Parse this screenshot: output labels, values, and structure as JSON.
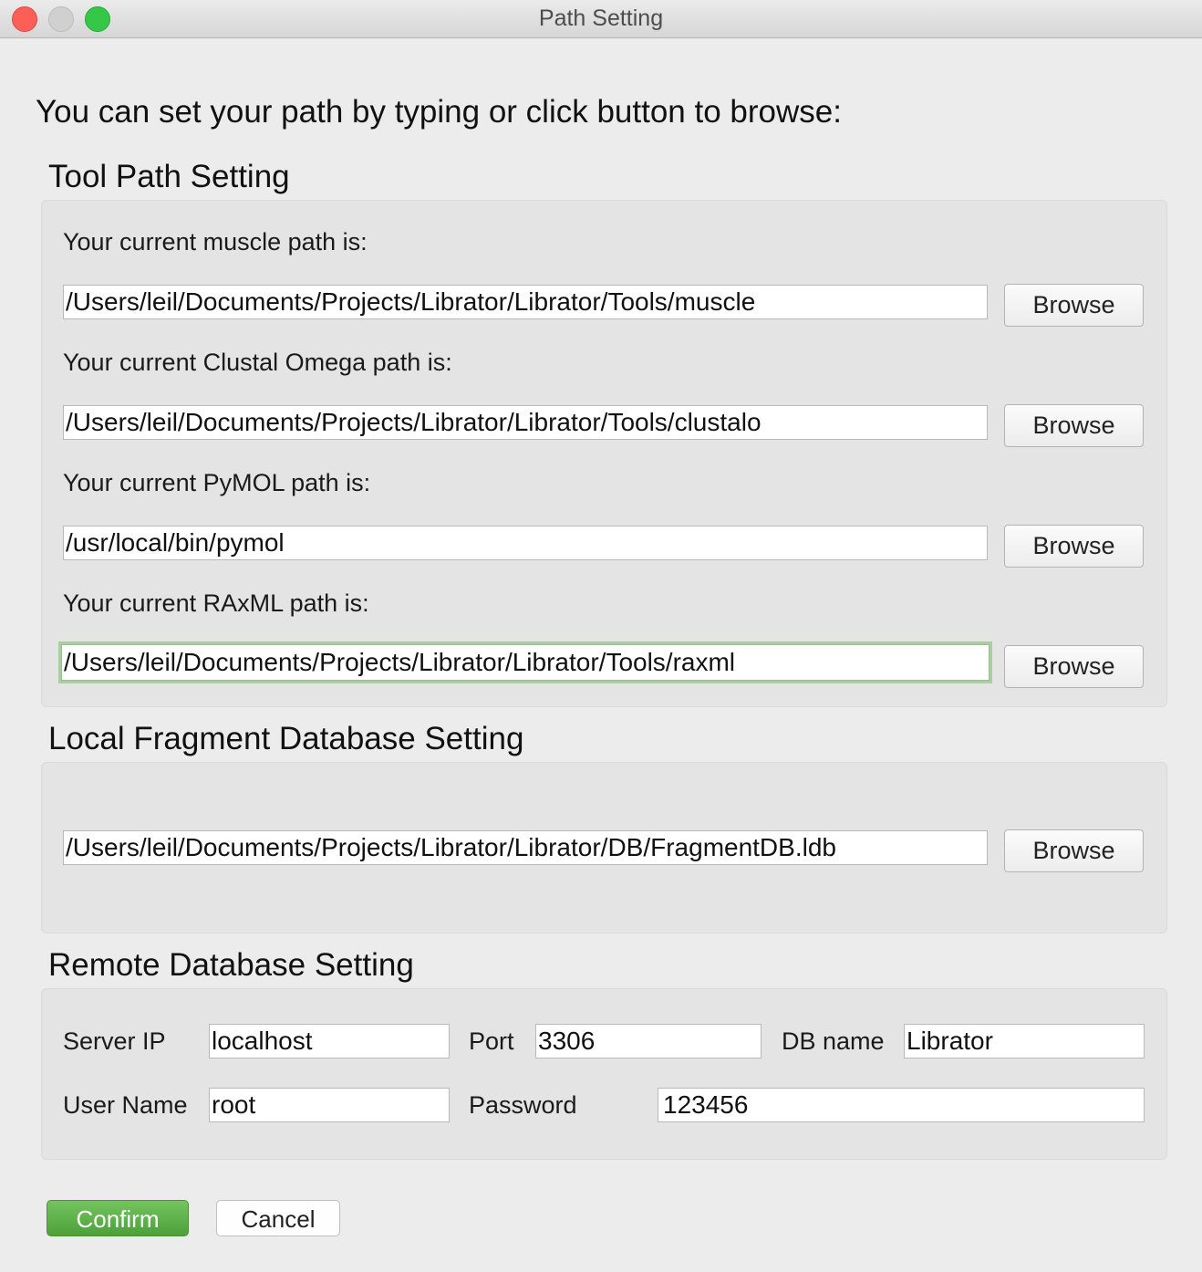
{
  "window": {
    "title": "Path Setting"
  },
  "intro": "You can set your path by typing or click button to browse:",
  "tool_section": {
    "title": "Tool Path Setting",
    "rows": [
      {
        "label": "Your current muscle path is:",
        "value": "/Users/leil/Documents/Projects/Librator/Librator/Tools/muscle",
        "button": "Browse"
      },
      {
        "label": "Your current Clustal Omega path is:",
        "value": "/Users/leil/Documents/Projects/Librator/Librator/Tools/clustalo",
        "button": "Browse"
      },
      {
        "label": "Your current PyMOL path is:",
        "value": "/usr/local/bin/pymol",
        "button": "Browse"
      },
      {
        "label": "Your current RAxML path is:",
        "value": "/Users/leil/Documents/Projects/Librator/Librator/Tools/raxml",
        "button": "Browse"
      }
    ]
  },
  "local_db_section": {
    "title": "Local Fragment Database Setting",
    "value": "/Users/leil/Documents/Projects/Librator/Librator/DB/FragmentDB.ldb",
    "button": "Browse"
  },
  "remote_db_section": {
    "title": "Remote Database Setting",
    "server_ip_label": "Server IP",
    "server_ip": "localhost",
    "port_label": "Port",
    "port": "3306",
    "db_name_label": "DB name",
    "db_name": "Librator",
    "user_name_label": "User Name",
    "user_name": "root",
    "password_label": "Password",
    "password": "123456"
  },
  "actions": {
    "confirm": "Confirm",
    "cancel": "Cancel"
  },
  "colors": {
    "confirm_green": "#5cb046",
    "focus_ring": "#a9cfa0",
    "close": "#fc5f57",
    "zoom": "#34c748"
  }
}
